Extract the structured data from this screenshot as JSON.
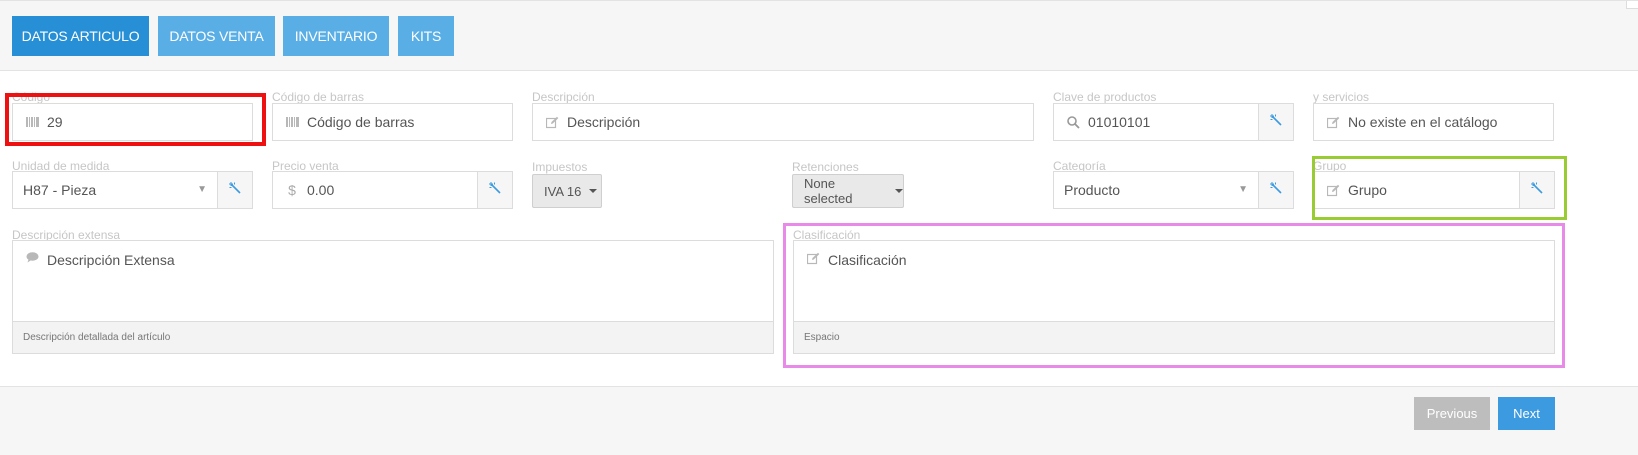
{
  "tabs": [
    {
      "label": "DATOS ARTICULO",
      "active": true
    },
    {
      "label": "DATOS VENTA",
      "active": false
    },
    {
      "label": "INVENTARIO",
      "active": false
    },
    {
      "label": "KITS",
      "active": false
    }
  ],
  "row1": {
    "codigo": {
      "label": "Código",
      "value": "29",
      "icon": "barcode-icon"
    },
    "codigo_barras": {
      "label": "Código de barras",
      "placeholder": "Código de barras",
      "icon": "barcode-icon"
    },
    "descripcion": {
      "label": "Descripción",
      "placeholder": "Descripción",
      "icon": "edit-icon"
    },
    "clave_productos": {
      "label": "Clave de productos",
      "value": "01010101",
      "icon": "search-icon"
    },
    "servicios": {
      "label": "y servicios",
      "value": "No existe en el catálogo",
      "icon": "edit-icon"
    }
  },
  "row2": {
    "unidad": {
      "label": "Unidad de medida",
      "value": "H87 - Pieza"
    },
    "precio": {
      "label": "Precio venta",
      "value": "0.00",
      "currency": "$"
    },
    "impuestos": {
      "label": "Impuestos",
      "value": "IVA 16"
    },
    "retenciones": {
      "label": "Retenciones",
      "value": "None selected"
    },
    "categoria": {
      "label": "Categoría",
      "value": "Producto"
    },
    "grupo": {
      "label": "Grupo",
      "placeholder": "Grupo",
      "icon": "edit-icon"
    }
  },
  "row3": {
    "desc_extensa": {
      "label": "Descripción extensa",
      "placeholder": "Descripción Extensa",
      "help": "Descripción detallada del artículo",
      "icon": "comment-icon"
    },
    "clasificacion": {
      "label": "Clasificación",
      "placeholder": "Clasificación",
      "help": "Espacio",
      "icon": "edit-icon"
    }
  },
  "footer": {
    "previous": "Previous",
    "next": "Next"
  },
  "colors": {
    "tab": "#5aaee6",
    "tab_active": "#268fd6",
    "highlight_red": "#ee1111",
    "highlight_green": "#99cc33",
    "highlight_pink": "#e88ae8",
    "next_button": "#3c9ae0",
    "previous_button": "#bdbdbd"
  }
}
